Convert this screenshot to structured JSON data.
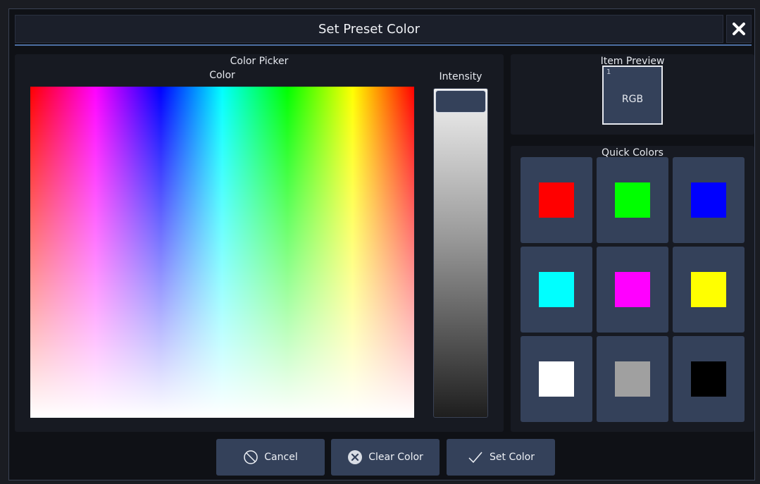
{
  "dialog": {
    "title": "Set Preset Color",
    "close_icon": "close-icon"
  },
  "picker": {
    "label": "Color Picker",
    "color_label": "Color",
    "intensity_label": "Intensity"
  },
  "preview": {
    "label": "Item Preview",
    "item_number": "1",
    "item_text": "RGB",
    "item_color": "#34415a"
  },
  "quick_colors": {
    "label": "Quick Colors",
    "colors": [
      "#ff0000",
      "#00ff00",
      "#0000ff",
      "#00ffff",
      "#ff00ff",
      "#ffff00",
      "#ffffff",
      "#a0a0a0",
      "#000000"
    ]
  },
  "buttons": {
    "cancel": "Cancel",
    "clear": "Clear Color",
    "set": "Set Color"
  },
  "theme": {
    "accent": "#4d6fa3",
    "button_bg": "#34415a",
    "panel_bg": "#171a22"
  }
}
